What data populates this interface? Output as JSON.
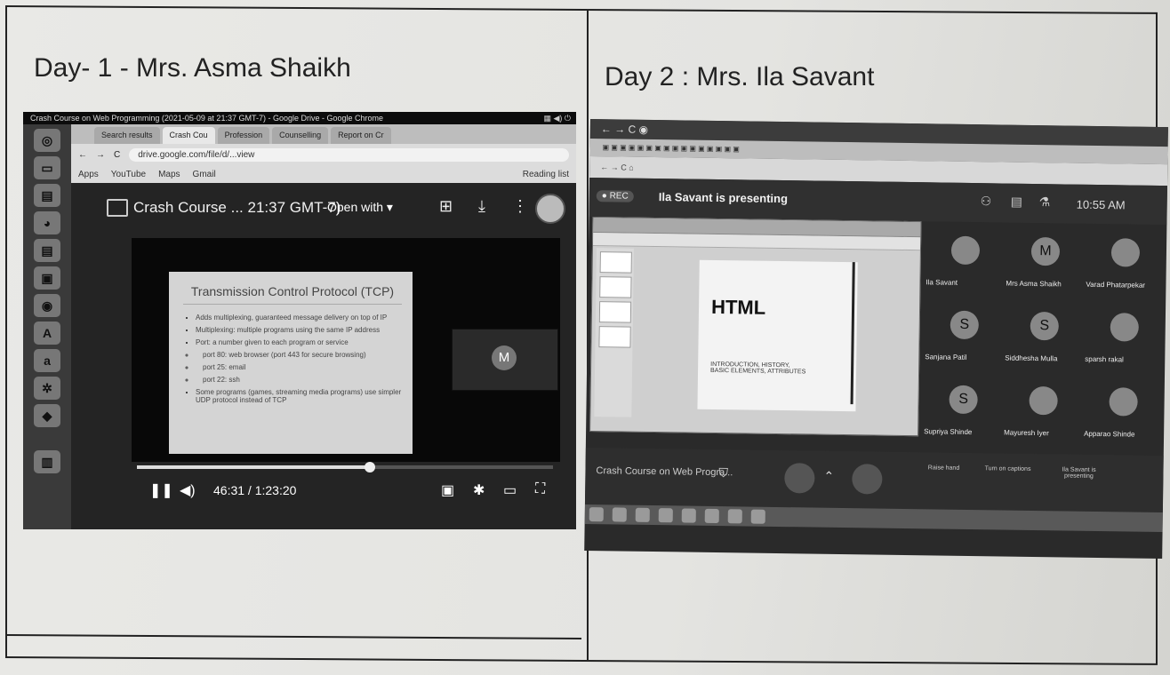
{
  "captions": {
    "day1": "Day- 1 - Mrs. Asma Shaikh",
    "day2": "Day 2 : Mrs. Ila Savant"
  },
  "shot1": {
    "window_title": "Crash Course on Web Programming (2021-05-09 at 21:37 GMT-7) - Google Drive - Google Chrome",
    "tabs": [
      "Search results",
      "Crash Cou",
      "Profession",
      "Counselling",
      "Report on Cr"
    ],
    "url": "drive.google.com/file/d/...view",
    "bookmarks": [
      "Apps",
      "YouTube",
      "Maps",
      "Gmail"
    ],
    "reading_list": "Reading list",
    "viewer_title": "Crash Course ... 21:37 GMT-7)",
    "open_with": "Open with",
    "slide_title": "Transmission Control Protocol (TCP)",
    "slide_bullets": [
      "Adds multiplexing, guaranteed message delivery on top of IP",
      "Multiplexing: multiple programs using the same IP address",
      "Port: a number given to each program or service",
      "port 80: web browser (port 443 for secure browsing)",
      "port 25: email",
      "port 22: ssh",
      "Some programs (games, streaming media programs) use simpler UDP protocol instead of TCP"
    ],
    "pip_initial": "M",
    "time": "46:31 / 1:23:20",
    "progress": 0.56
  },
  "shot2": {
    "presenting": "Ila Savant is presenting",
    "clock": "10:55 AM",
    "slide_heading": "HTML",
    "slide_sub": "INTRODUCTION, HISTORY, BASIC ELEMENTS, ATTRIBUTES",
    "participants": [
      {
        "name": "Ila Savant",
        "initial": ""
      },
      {
        "name": "Mrs Asma Shaikh",
        "initial": "M"
      },
      {
        "name": "Varad Phatarpekar",
        "initial": ""
      },
      {
        "name": "Sanjana Patil",
        "initial": "S"
      },
      {
        "name": "Siddhesha Mulla",
        "initial": "S"
      },
      {
        "name": "sparsh rakal",
        "initial": ""
      },
      {
        "name": "Supriya Shinde",
        "initial": "S"
      },
      {
        "name": "Mayuresh Iyer",
        "initial": ""
      },
      {
        "name": "Apparao Shinde",
        "initial": ""
      }
    ],
    "meeting_title": "Crash Course on Web Progra...",
    "actions": [
      "Raise hand",
      "Turn on captions",
      "Ila Savant is presenting"
    ]
  }
}
